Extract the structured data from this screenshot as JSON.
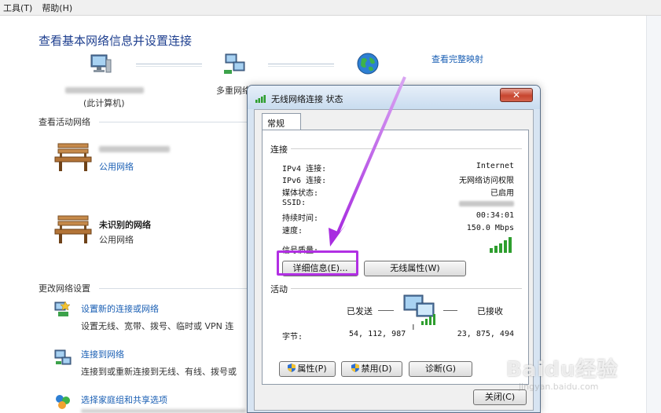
{
  "menu": {
    "tools": "工具(T)",
    "help": "帮助(H)"
  },
  "main": {
    "heading": "查看基本网络信息并设置连接",
    "view_full_map": "查看完整映射",
    "this_computer": "(此计算机)",
    "multi_network": "多重网络",
    "active_networks_title": "查看活动网络",
    "networks": [
      {
        "name": "",
        "type": "公用网络",
        "type_is_link": true
      },
      {
        "name": "未识别的网络",
        "type": "公用网络",
        "type_is_link": false
      }
    ],
    "change_settings_title": "更改网络设置",
    "tasks": [
      {
        "link": "设置新的连接或网络",
        "desc": "设置无线、宽带、拨号、临时或 VPN 连"
      },
      {
        "link": "连接到网络",
        "desc": "连接到或重新连接到无线、有线、拨号或"
      },
      {
        "link": "选择家庭组和共享选项",
        "desc": ""
      }
    ]
  },
  "dialog": {
    "title": "无线网络连接 状态",
    "close_glyph": "✕",
    "tab_general": "常规",
    "connection_group": "连接",
    "rows": [
      {
        "label": "IPv4 连接:",
        "value": "Internet"
      },
      {
        "label": "IPv6 连接:",
        "value": "无网络访问权限"
      },
      {
        "label": "媒体状态:",
        "value": "已启用"
      },
      {
        "label": "SSID:",
        "value": ""
      },
      {
        "label": "持续时间:",
        "value": "00:34:01"
      },
      {
        "label": "速度:",
        "value": "150.0 Mbps"
      }
    ],
    "signal_label": "信号质量:",
    "signal_bars": 5,
    "details_button": "详细信息(E)...",
    "wireless_props_button": "无线属性(W)",
    "activity_group": "活动",
    "sent_label": "已发送",
    "received_label": "已接收",
    "bytes_label": "字节:",
    "bytes_sent": "54, 112, 987",
    "bytes_received": "23, 875, 494",
    "properties_button": "属性(P)",
    "disable_button": "禁用(D)",
    "diagnose_button": "诊断(G)",
    "close_button": "关闭(C)"
  },
  "watermark": {
    "brand": "Baidu经验",
    "sub": "jingyan.baidu.com"
  },
  "colors": {
    "link": "#1a5fb4",
    "heading": "#1e3f8f",
    "highlight": "#b12fe3",
    "signal": "#2e9e2e"
  }
}
